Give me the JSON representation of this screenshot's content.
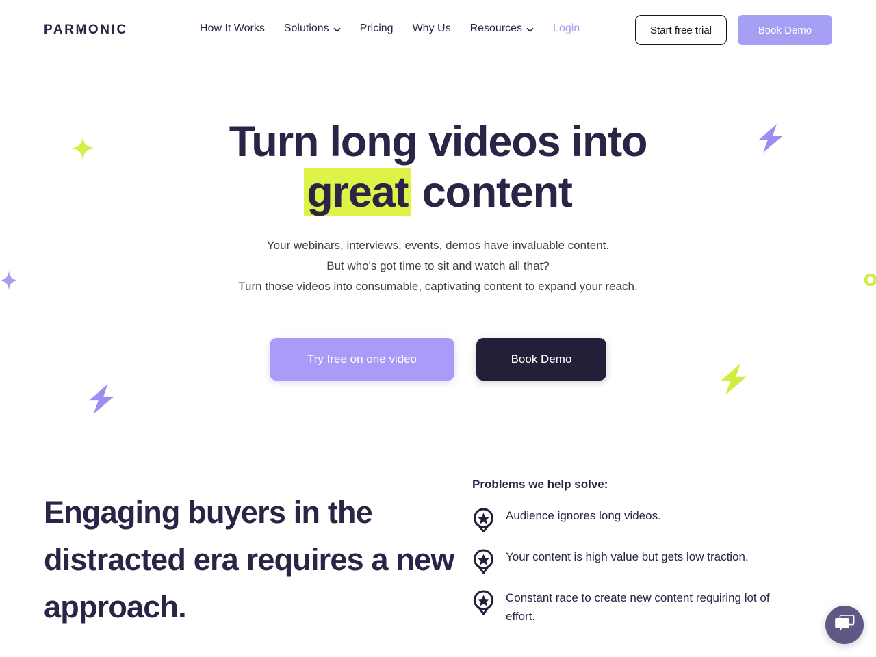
{
  "header": {
    "logo": "PARMONIC",
    "nav": [
      {
        "label": "How It Works",
        "has_chevron": false,
        "icon": ""
      },
      {
        "label": "Solutions",
        "has_chevron": true,
        "icon": "chevron-down-icon"
      },
      {
        "label": "Pricing",
        "has_chevron": false,
        "icon": ""
      },
      {
        "label": "Why Us",
        "has_chevron": false,
        "icon": ""
      },
      {
        "label": "Resources",
        "has_chevron": true,
        "icon": "chevron-down-icon"
      }
    ],
    "login_label": "Login",
    "trial_button_label": "Start free trial",
    "demo_button_label": "Book Demo"
  },
  "hero": {
    "title_line1": "Turn long videos into",
    "title_highlight": "great",
    "title_after_highlight": " content",
    "sub_line1": "Your webinars, interviews, events, demos have invaluable content.",
    "sub_line2": "But who's got time to sit and watch all that?",
    "sub_line3": "Turn those videos into consumable, captivating content to expand your reach.",
    "cta_primary_label": "Try free on one video",
    "cta_secondary_label": "Book Demo"
  },
  "lower": {
    "heading": "Engaging buyers in the distracted era requires a new approach.",
    "problems_title": "Problems we help solve:",
    "problems": [
      {
        "text": "Audience ignores long videos.",
        "icon": "star-badge-icon"
      },
      {
        "text": "Your content is high value but gets low traction.",
        "icon": "star-badge-icon"
      },
      {
        "text": "Constant race to create new content requiring lot of effort.",
        "icon": "star-badge-icon"
      }
    ]
  },
  "chat": {
    "icon": "chat-bubbles-icon"
  },
  "decorations": [
    {
      "name": "sparkle-lime-left",
      "shape": "four-point-star",
      "color": "#d4ef4a"
    },
    {
      "name": "bolt-purple-top-right",
      "shape": "lightning-bolt",
      "color": "#9b8ef0"
    },
    {
      "name": "star-purple-left-edge",
      "shape": "four-point-star",
      "color": "#a79cf0"
    },
    {
      "name": "ring-lime-right-edge",
      "shape": "ring",
      "color": "#cdee3f"
    },
    {
      "name": "bolt-purple-bottom-left",
      "shape": "lightning-bolt",
      "color": "#9b8ef0"
    },
    {
      "name": "bolt-lime-bottom-right",
      "shape": "lightning-bolt",
      "color": "#cdee3f"
    }
  ],
  "colors": {
    "brand_navy": "#2a2446",
    "accent_purple": "#a6a0f5",
    "accent_lime": "#dff247",
    "background": "#ffffff",
    "chat_bubble": "#5f5884"
  }
}
